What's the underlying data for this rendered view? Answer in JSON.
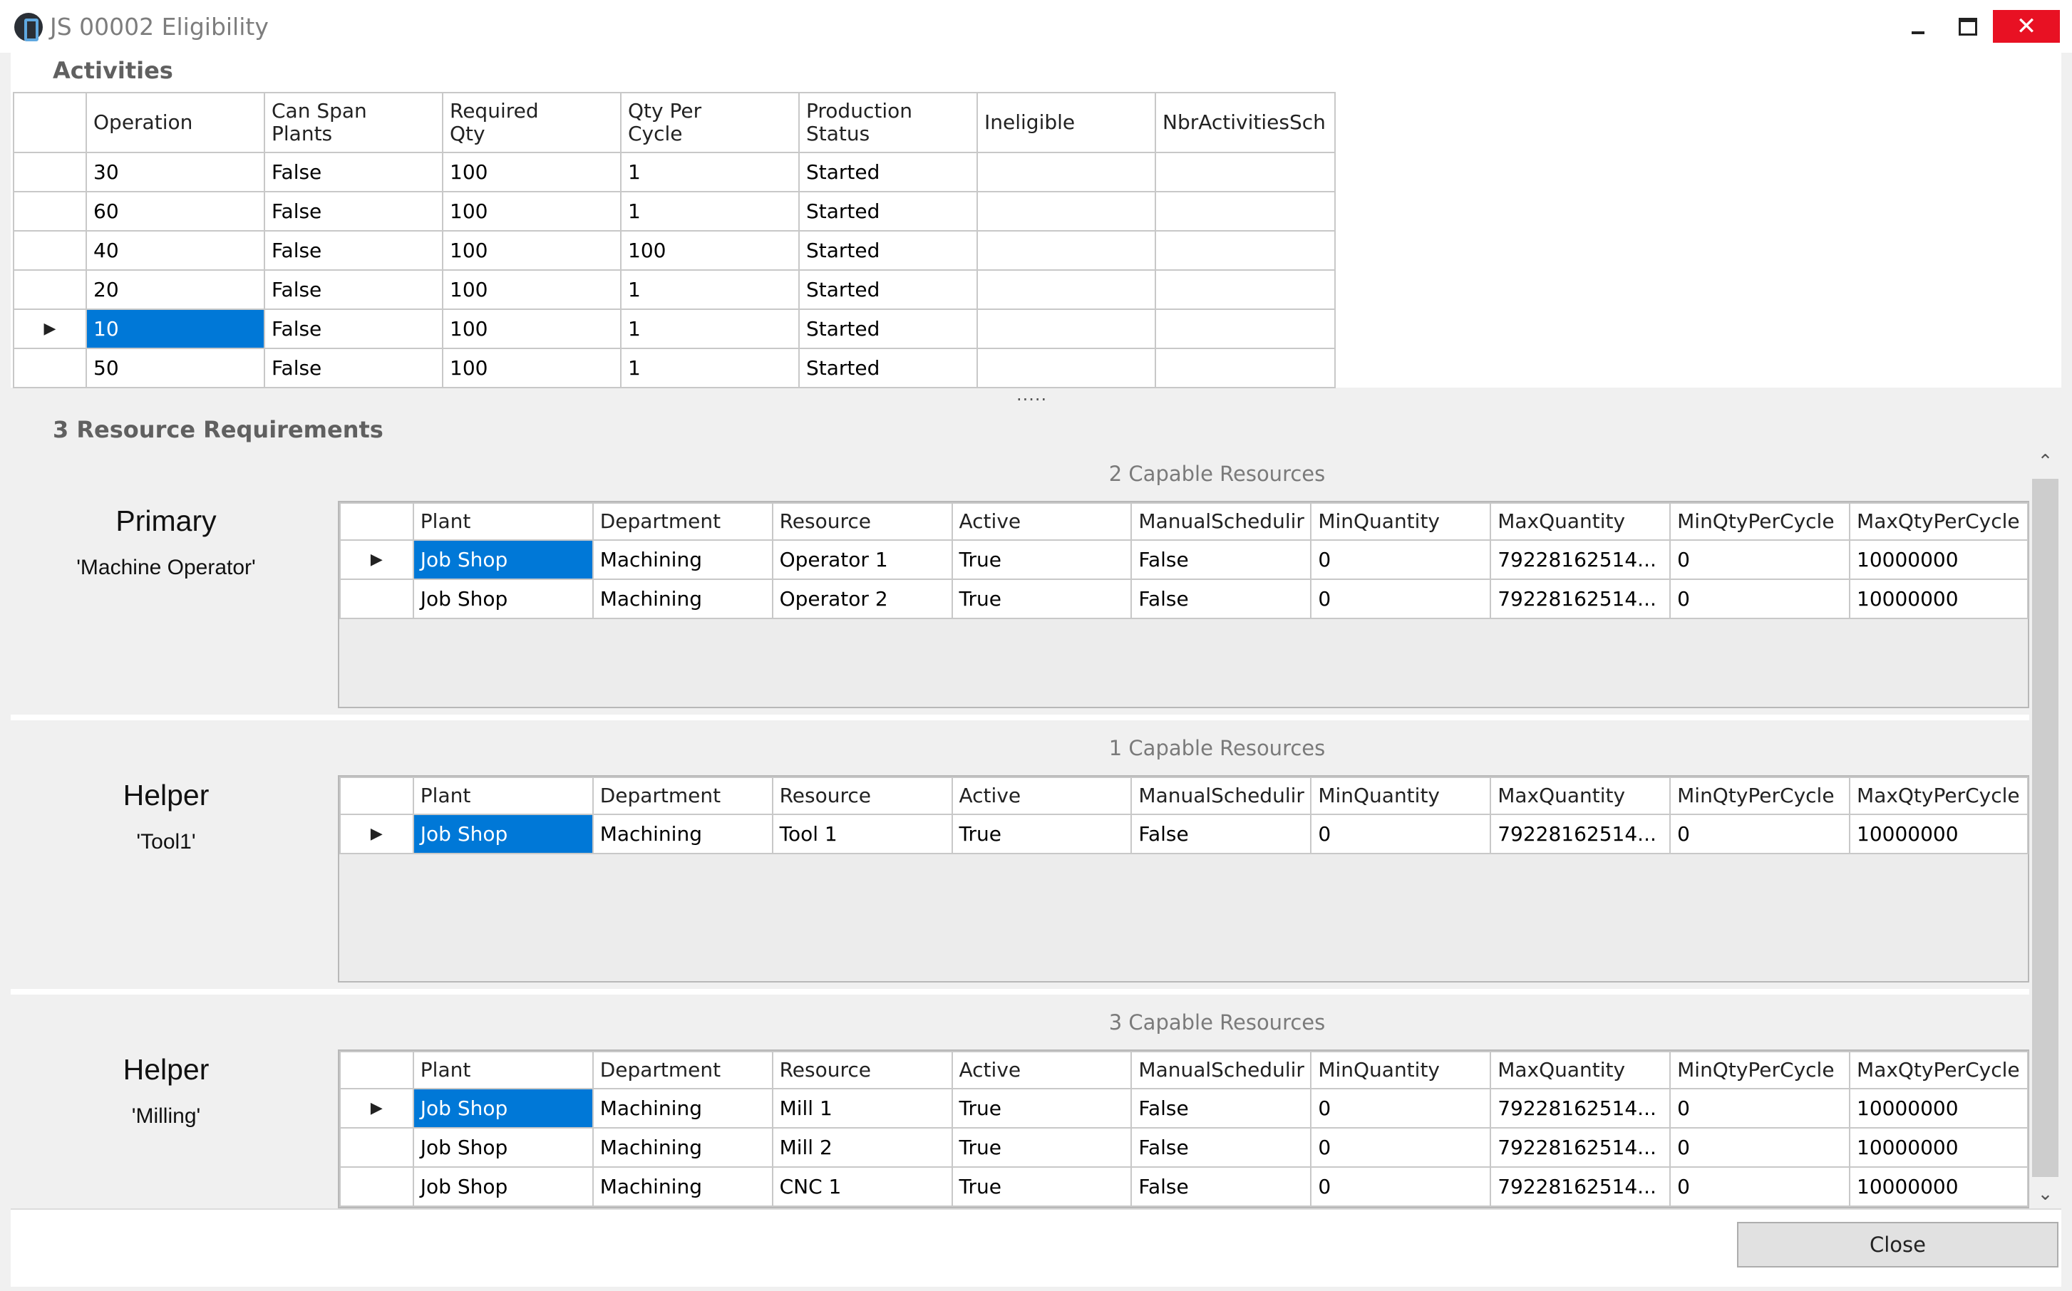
{
  "window": {
    "title": "JS 00002 Eligibility",
    "minimize_glyph": "",
    "maximize_glyph": "",
    "close_glyph": "✕"
  },
  "activities": {
    "header": "Activities",
    "columns": [
      "Operation",
      "Can Span\nPlants",
      "Required\nQty",
      "Qty Per\nCycle",
      "Production\nStatus",
      "Ineligible",
      "NbrActivitiesSch"
    ],
    "rows": [
      {
        "operation": "30",
        "can_span": "False",
        "required_qty": "100",
        "qty_per_cycle": "1",
        "status": "Started",
        "ineligible": "",
        "nbr": ""
      },
      {
        "operation": "60",
        "can_span": "False",
        "required_qty": "100",
        "qty_per_cycle": "1",
        "status": "Started",
        "ineligible": "",
        "nbr": ""
      },
      {
        "operation": "40",
        "can_span": "False",
        "required_qty": "100",
        "qty_per_cycle": "100",
        "status": "Started",
        "ineligible": "",
        "nbr": ""
      },
      {
        "operation": "20",
        "can_span": "False",
        "required_qty": "100",
        "qty_per_cycle": "1",
        "status": "Started",
        "ineligible": "",
        "nbr": ""
      },
      {
        "operation": "10",
        "can_span": "False",
        "required_qty": "100",
        "qty_per_cycle": "1",
        "status": "Started",
        "ineligible": "",
        "nbr": ""
      },
      {
        "operation": "50",
        "can_span": "False",
        "required_qty": "100",
        "qty_per_cycle": "1",
        "status": "Started",
        "ineligible": "",
        "nbr": ""
      }
    ],
    "selected_row": 4,
    "current_marker": "▶"
  },
  "splitter": ".....",
  "requirements": {
    "header": "3 Resource Requirements",
    "columns": [
      "Plant",
      "Department",
      "Resource",
      "Active",
      "ManualSchedulir",
      "MinQuantity",
      "MaxQuantity",
      "MinQtyPerCycle",
      "MaxQtyPerCycle"
    ],
    "groups": [
      {
        "role": "Primary",
        "capability": "'Machine Operator'",
        "capable_label": "2 Capable Resources",
        "rows": [
          [
            "Job Shop",
            "Machining",
            "Operator 1",
            "True",
            "False",
            "0",
            "79228162514...",
            "0",
            "10000000"
          ],
          [
            "Job Shop",
            "Machining",
            "Operator 2",
            "True",
            "False",
            "0",
            "79228162514...",
            "0",
            "10000000"
          ]
        ]
      },
      {
        "role": "Helper",
        "capability": "'Tool1'",
        "capable_label": "1 Capable Resources",
        "rows": [
          [
            "Job Shop",
            "Machining",
            "Tool 1",
            "True",
            "False",
            "0",
            "79228162514...",
            "0",
            "10000000"
          ]
        ]
      },
      {
        "role": "Helper",
        "capability": "'Milling'",
        "capable_label": "3 Capable Resources",
        "rows": [
          [
            "Job Shop",
            "Machining",
            "Mill 1",
            "True",
            "False",
            "0",
            "79228162514...",
            "0",
            "10000000"
          ],
          [
            "Job Shop",
            "Machining",
            "Mill 2",
            "True",
            "False",
            "0",
            "79228162514...",
            "0",
            "10000000"
          ],
          [
            "Job Shop",
            "Machining",
            "CNC 1",
            "True",
            "False",
            "0",
            "79228162514...",
            "0",
            "10000000"
          ]
        ]
      }
    ]
  },
  "scrollbar": {
    "up": "⌃",
    "down": "⌄"
  },
  "footer": {
    "close_label": "Close"
  },
  "colors": {
    "selection": "#0078d7",
    "close_hover": "#e81123"
  }
}
